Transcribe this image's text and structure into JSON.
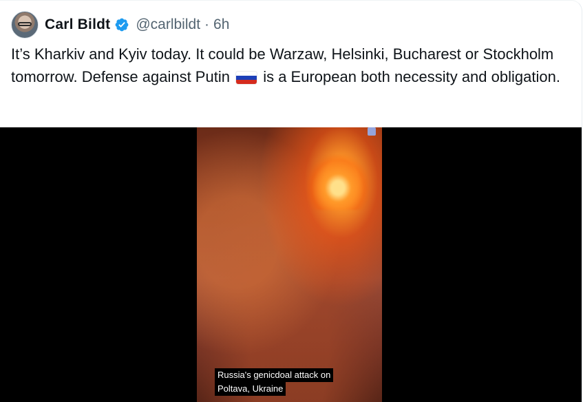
{
  "tweet": {
    "author_name": "Carl Bildt",
    "handle": "@carlbildt",
    "separator": "·",
    "time": "6h",
    "text_part1": "It’s Kharkiv and Kyiv today. It could be Warzaw, Helsinki, Bucharest or Stockholm tomorrow. Defense against Putin",
    "text_part2": "is a European both necessity and obligation.",
    "flag_icon": "russia-flag-icon",
    "verified_icon": "verified-badge-icon",
    "verified_color": "#1d9bf0"
  },
  "media": {
    "type": "video",
    "caption_line1": "Russia's genicdoal attack on",
    "caption_line2": "Poltava, Ukraine"
  }
}
